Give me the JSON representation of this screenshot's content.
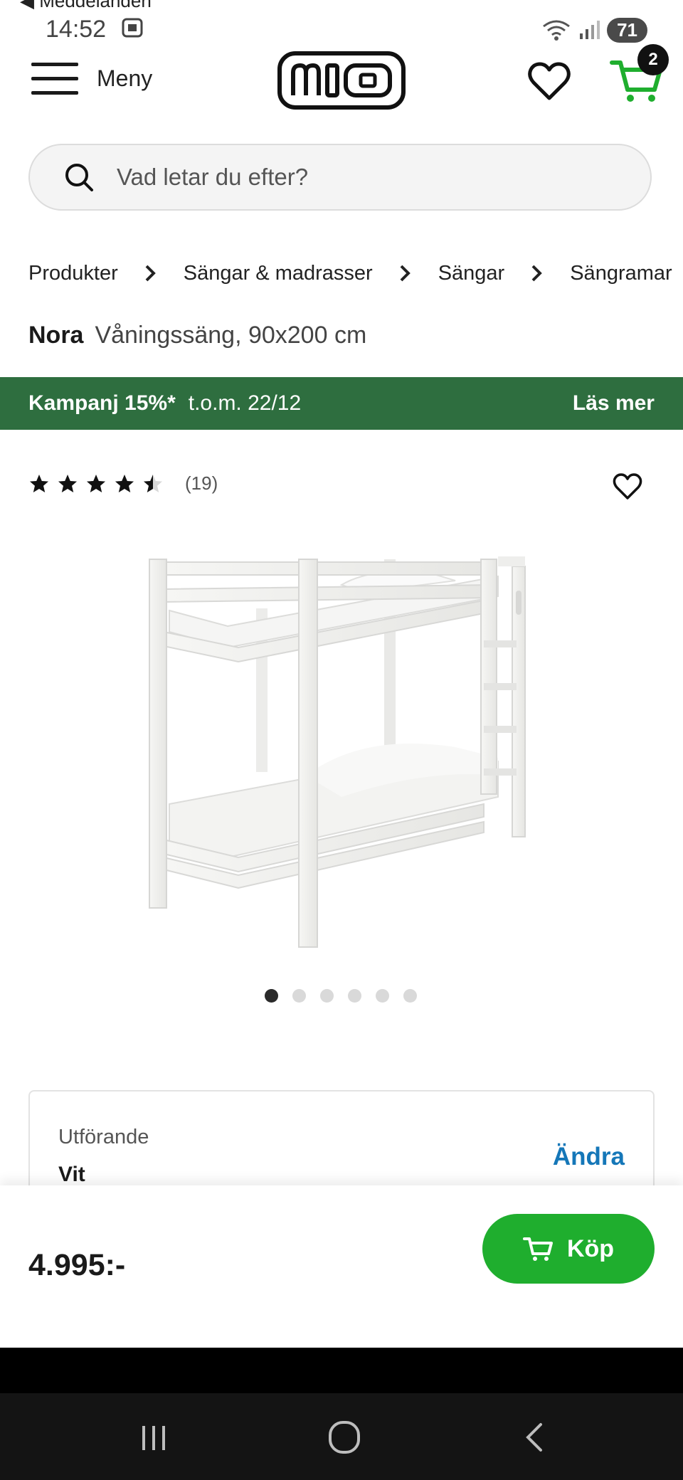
{
  "status_bar": {
    "back_app": "◀ Meddelanden",
    "time": "14:52",
    "battery": "71"
  },
  "header": {
    "menu_label": "Meny",
    "logo_alt": "mio",
    "cart_count": "2"
  },
  "search": {
    "placeholder": "Vad letar du efter?"
  },
  "breadcrumb": [
    "Produkter",
    "Sängar & madrasser",
    "Sängar",
    "Sängramar"
  ],
  "product": {
    "brand": "Nora",
    "description": "Våningssäng, 90x200 cm",
    "rating": 4.5,
    "review_count": "(19)",
    "image_count": 6,
    "active_image": 0
  },
  "promo": {
    "campaign": "Kampanj 15%*",
    "period": "t.o.m. 22/12",
    "more": "Läs mer"
  },
  "variant": {
    "label": "Utförande",
    "value": "Vit",
    "change": "Ändra"
  },
  "buy_bar": {
    "price": "4.995:-",
    "buy_label": "Köp"
  },
  "colors": {
    "promo_green": "#2e6e3f",
    "buy_green": "#1fae2e",
    "link_blue": "#1577b8",
    "cart_green": "#1fae2e"
  }
}
